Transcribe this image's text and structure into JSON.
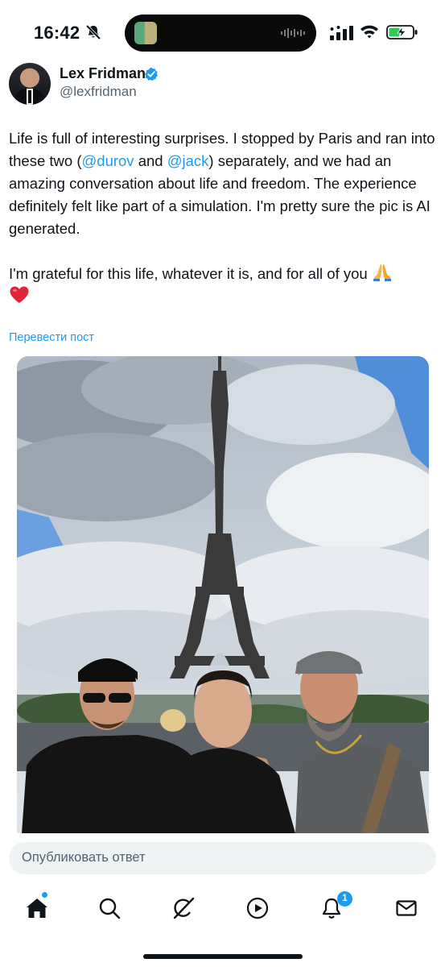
{
  "status_bar": {
    "time": "16:42",
    "icons": [
      "bell-slash-icon",
      "signal-icon",
      "wifi-icon",
      "battery-charging-icon"
    ]
  },
  "author": {
    "name": "Lex Fridman",
    "handle": "@lexfridman",
    "verified": true,
    "verified_color": "#1d9bf0"
  },
  "tweet": {
    "line1_before": "Life is full of interesting surprises. I stopped by Paris and ran into these two (",
    "mention1": "@durov",
    "and_word": " and ",
    "mention2": "@jack",
    "line1_after": ") separately, and we had an amazing conversation about life and freedom. The experience definitely felt like part of a simulation. I'm pretty sure the pic is AI generated.",
    "line2": "I'm grateful for this life, whatever it is, and for all of you",
    "emojis": [
      "folded-hands-emoji",
      "red-heart-emoji"
    ]
  },
  "translate_link": "Перевести пост",
  "reply": {
    "placeholder": "Опубликовать ответ"
  },
  "nav": {
    "items": [
      "home-icon",
      "search-icon",
      "grok-icon",
      "video-icon",
      "notifications-icon",
      "messages-icon"
    ],
    "notifications_badge": "1"
  },
  "colors": {
    "accent": "#1d9bf0",
    "text": "#0f1419",
    "secondary_text": "#536471",
    "reply_bg": "#eff3f4"
  }
}
